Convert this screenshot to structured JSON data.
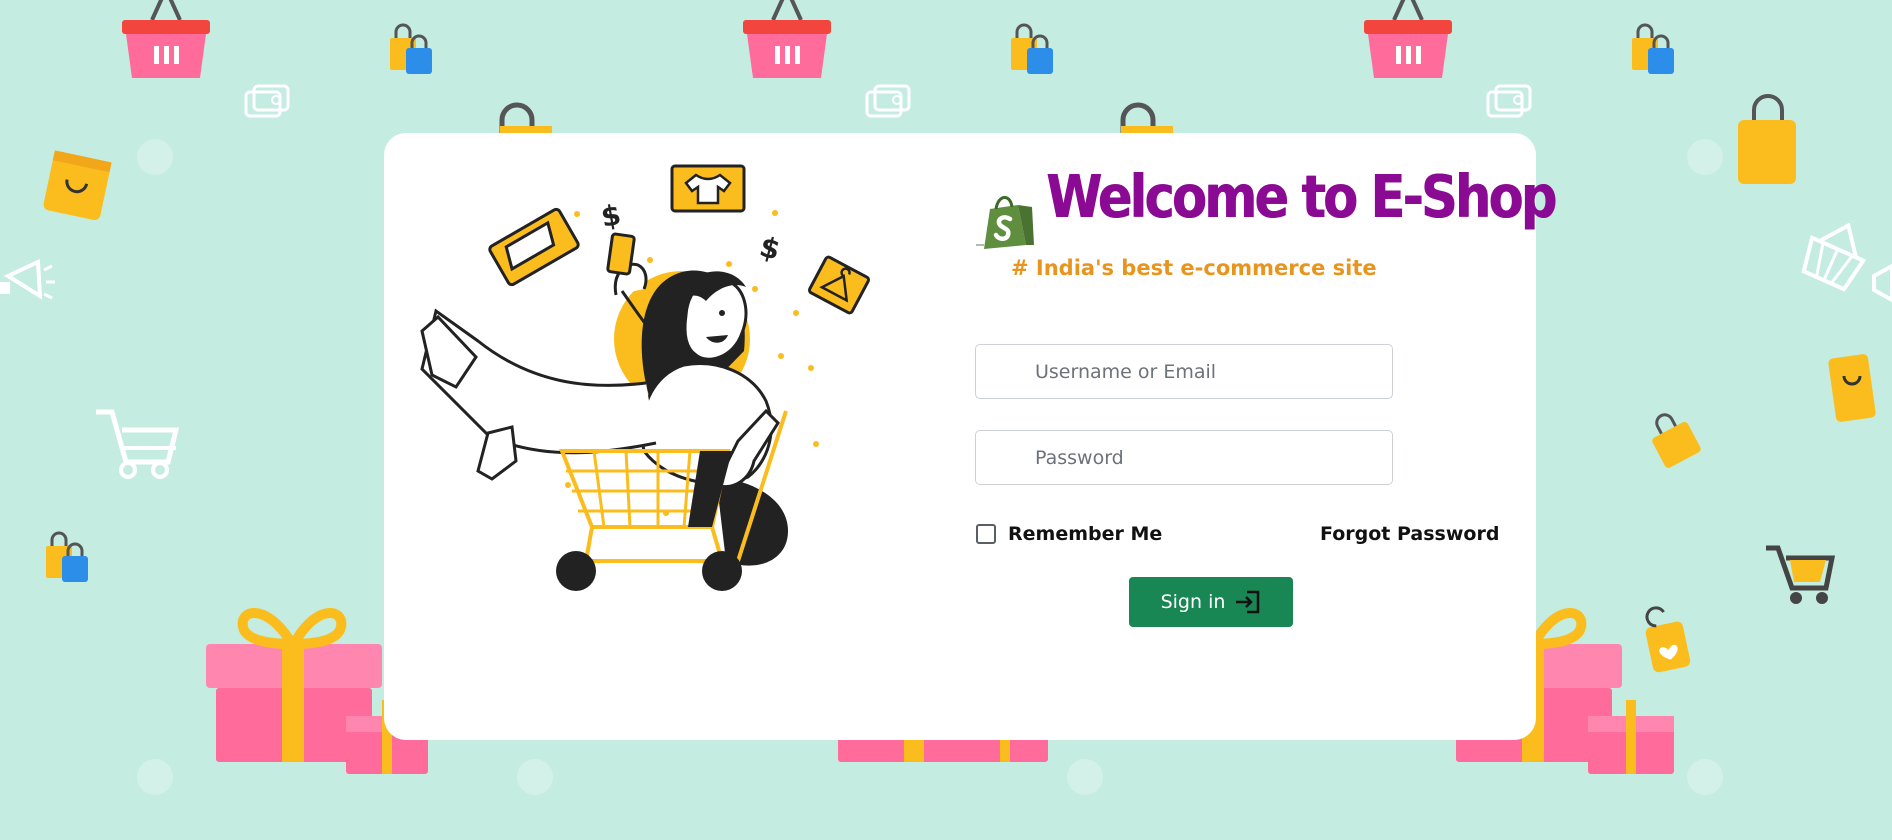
{
  "login": {
    "title": "Welcome to E-Shop",
    "subtitle": "# India's best e-commerce site",
    "username_placeholder": "Username or Email",
    "password_placeholder": "Password",
    "remember_label": "Remember Me",
    "forgot_label": "Forgot Password",
    "signin_label": "Sign in"
  },
  "colors": {
    "background": "#c5ece1",
    "title": "#8b0a93",
    "subtitle": "#e8951e",
    "button": "#198754",
    "accent_yellow": "#fbbd1e",
    "accent_pink": "#ff6b9a"
  },
  "icons": {
    "logo": "shopify-bag-icon",
    "illustration": "woman-in-shopping-cart-illustration",
    "signin": "sign-in-arrow-icon"
  }
}
